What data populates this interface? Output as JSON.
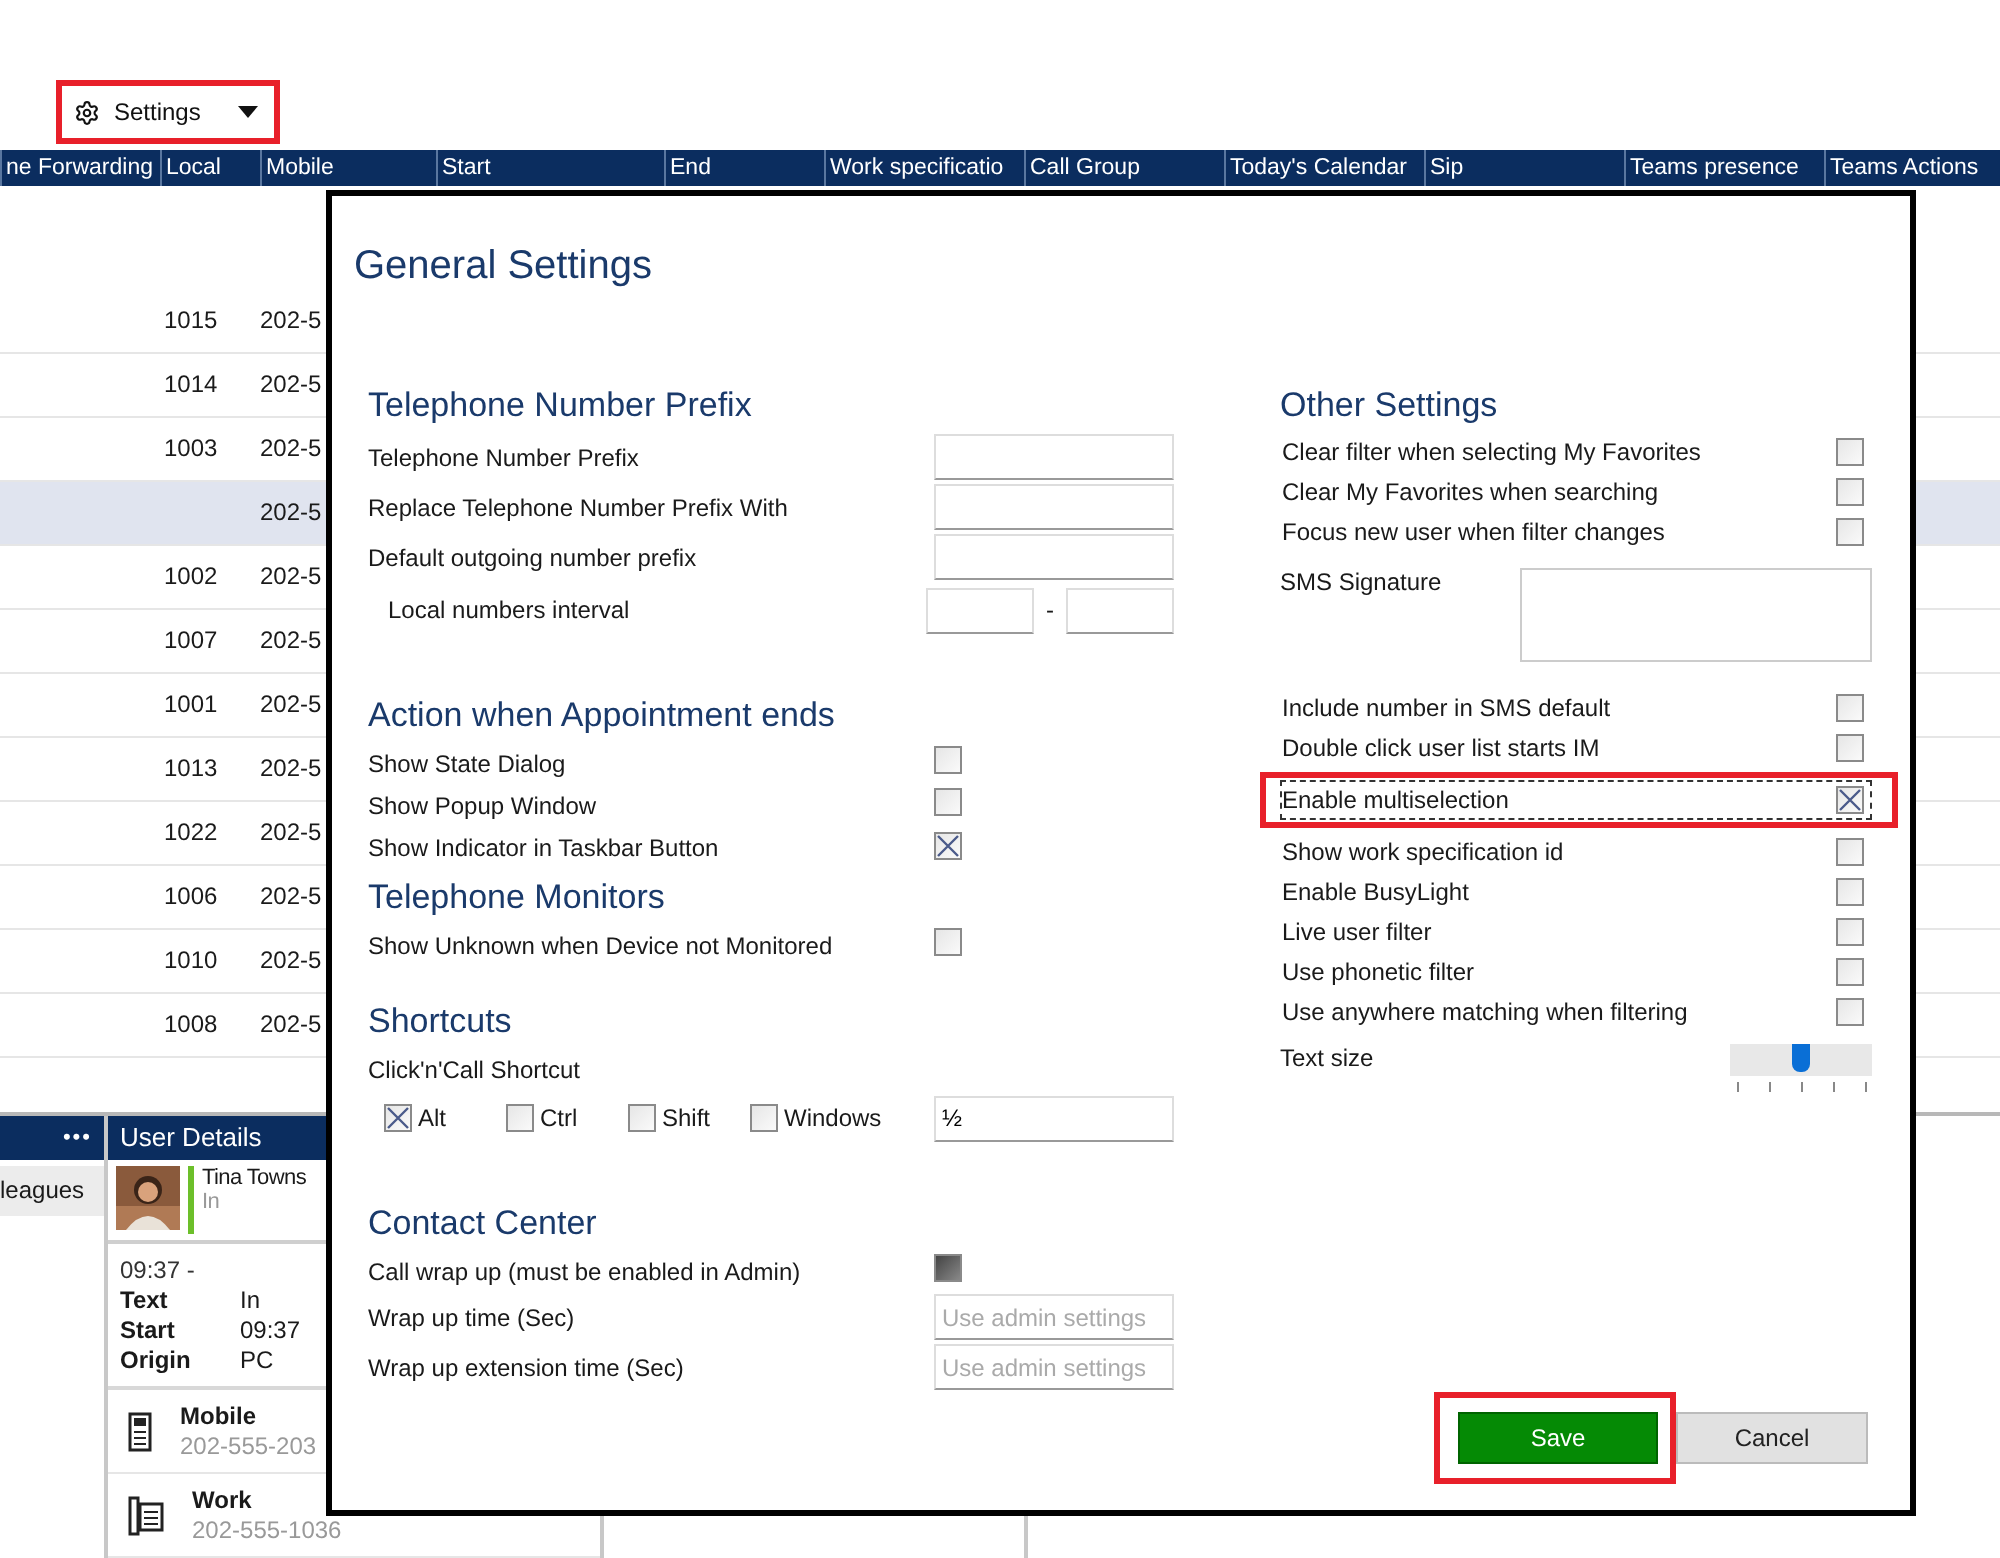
{
  "toolbar": {
    "settings_button": {
      "label": "Settings",
      "annotated": true
    }
  },
  "table": {
    "columns": [
      "ne Forwarding",
      "Local",
      "Mobile",
      "Start",
      "End",
      "Work specificatio",
      "Call Group",
      "Today's Calendar",
      "Sip",
      "Teams presence",
      "Teams Actions"
    ],
    "rows": [
      {
        "local": "1015",
        "mobile": "202-5",
        "selected": false
      },
      {
        "local": "1014",
        "mobile": "202-5",
        "selected": false
      },
      {
        "local": "1003",
        "mobile": "202-5",
        "selected": false
      },
      {
        "mobile": "202-5",
        "selected": true
      },
      {
        "local": "1002",
        "mobile": "202-5",
        "selected": false
      },
      {
        "local": "1007",
        "mobile": "202-5",
        "selected": false
      },
      {
        "local": "1001",
        "mobile": "202-5",
        "selected": false
      },
      {
        "local": "1013",
        "mobile": "202-5",
        "selected": false
      },
      {
        "local": "1022",
        "mobile": "202-5",
        "selected": false
      },
      {
        "local": "1006",
        "mobile": "202-5",
        "selected": false
      },
      {
        "local": "1010",
        "mobile": "202-5",
        "selected": false
      },
      {
        "local": "1008",
        "mobile": "202-5",
        "selected": false
      }
    ]
  },
  "bottom_panel": {
    "menu_glyph": "•••",
    "tab": "leagues",
    "user_details": {
      "title": "User Details",
      "name": "Tina Towns",
      "presence": "In",
      "time": "09:37 -",
      "fields": [
        {
          "label": "Text",
          "value": "In"
        },
        {
          "label": "Start",
          "value": "09:37"
        },
        {
          "label": "Origin",
          "value": "PC"
        }
      ],
      "phones": [
        {
          "kind": "mobile",
          "label": "Mobile",
          "number": "202-555-203"
        },
        {
          "kind": "work",
          "label": "Work",
          "number": "202-555-1036"
        }
      ]
    }
  },
  "dialog": {
    "title": "General Settings",
    "left_sections": [
      {
        "title": "Telephone Number Prefix",
        "items": [
          {
            "kind": "field",
            "label": "Telephone Number Prefix"
          },
          {
            "kind": "field",
            "label": "Replace Telephone Number Prefix With"
          },
          {
            "kind": "field",
            "label": "Default outgoing number prefix"
          },
          {
            "kind": "range",
            "label": "Local numbers interval",
            "separator": "-"
          }
        ]
      },
      {
        "title": "Action when Appointment ends",
        "items": [
          {
            "kind": "checkbox",
            "label": "Show State Dialog",
            "checked": false
          },
          {
            "kind": "checkbox",
            "label": "Show Popup Window",
            "checked": false
          },
          {
            "kind": "checkbox",
            "label": "Show Indicator in Taskbar Button",
            "checked": true
          }
        ]
      },
      {
        "title": "Telephone Monitors",
        "items": [
          {
            "kind": "checkbox",
            "label": "Show Unknown when Device not Monitored",
            "checked": false
          }
        ]
      },
      {
        "title": "Shortcuts",
        "items": [
          {
            "kind": "shortcut",
            "label": "Click'n'Call Shortcut",
            "key": "½",
            "modifiers": [
              {
                "label": "Alt",
                "checked": true
              },
              {
                "label": "Ctrl",
                "checked": false
              },
              {
                "label": "Shift",
                "checked": false
              },
              {
                "label": "Windows",
                "checked": false
              }
            ]
          }
        ]
      },
      {
        "title": "Contact Center",
        "items": [
          {
            "kind": "checkbox",
            "label": "Call wrap up (must be enabled in Admin)",
            "checked": true,
            "disabled": true
          },
          {
            "kind": "field",
            "label": "Wrap up time (Sec)",
            "placeholder": "Use admin settings"
          },
          {
            "kind": "field",
            "label": "Wrap up extension time (Sec)",
            "placeholder": "Use admin settings"
          }
        ]
      }
    ],
    "right_section": {
      "title": "Other Settings",
      "items": [
        {
          "kind": "checkbox",
          "label": "Clear filter when selecting My Favorites",
          "checked": false,
          "focused": false,
          "annotated": false
        },
        {
          "kind": "checkbox",
          "label": "Clear My Favorites when searching",
          "checked": false,
          "focused": false,
          "annotated": false
        },
        {
          "kind": "checkbox",
          "label": "Focus new user when filter changes",
          "checked": false,
          "focused": false,
          "annotated": false
        },
        {
          "kind": "textarea",
          "label": "SMS Signature"
        },
        {
          "kind": "checkbox",
          "label": "Include number in SMS default",
          "checked": false,
          "focused": false,
          "annotated": false
        },
        {
          "kind": "checkbox",
          "label": "Double click user list starts IM",
          "checked": false,
          "focused": false,
          "annotated": false
        },
        {
          "kind": "checkbox",
          "label": "Enable  multiselection",
          "checked": true,
          "focused": true,
          "annotated": true
        },
        {
          "kind": "checkbox",
          "label": "Show work specification id",
          "checked": false,
          "focused": false,
          "annotated": false
        },
        {
          "kind": "checkbox",
          "label": "Enable BusyLight",
          "checked": false,
          "focused": false,
          "annotated": false
        },
        {
          "kind": "checkbox",
          "label": "Live user filter",
          "checked": false,
          "focused": false,
          "annotated": false
        },
        {
          "kind": "checkbox",
          "label": "Use phonetic filter",
          "checked": false,
          "focused": false,
          "annotated": false
        },
        {
          "kind": "checkbox",
          "label": "Use anywhere matching when filtering",
          "checked": false,
          "focused": false,
          "annotated": false
        },
        {
          "kind": "slider",
          "label": "Text size",
          "level": 0.5
        }
      ]
    },
    "buttons": [
      {
        "kind": "primary",
        "label": "Save",
        "annotated": true
      },
      {
        "kind": "secondary",
        "label": "Cancel",
        "annotated": false
      }
    ]
  }
}
